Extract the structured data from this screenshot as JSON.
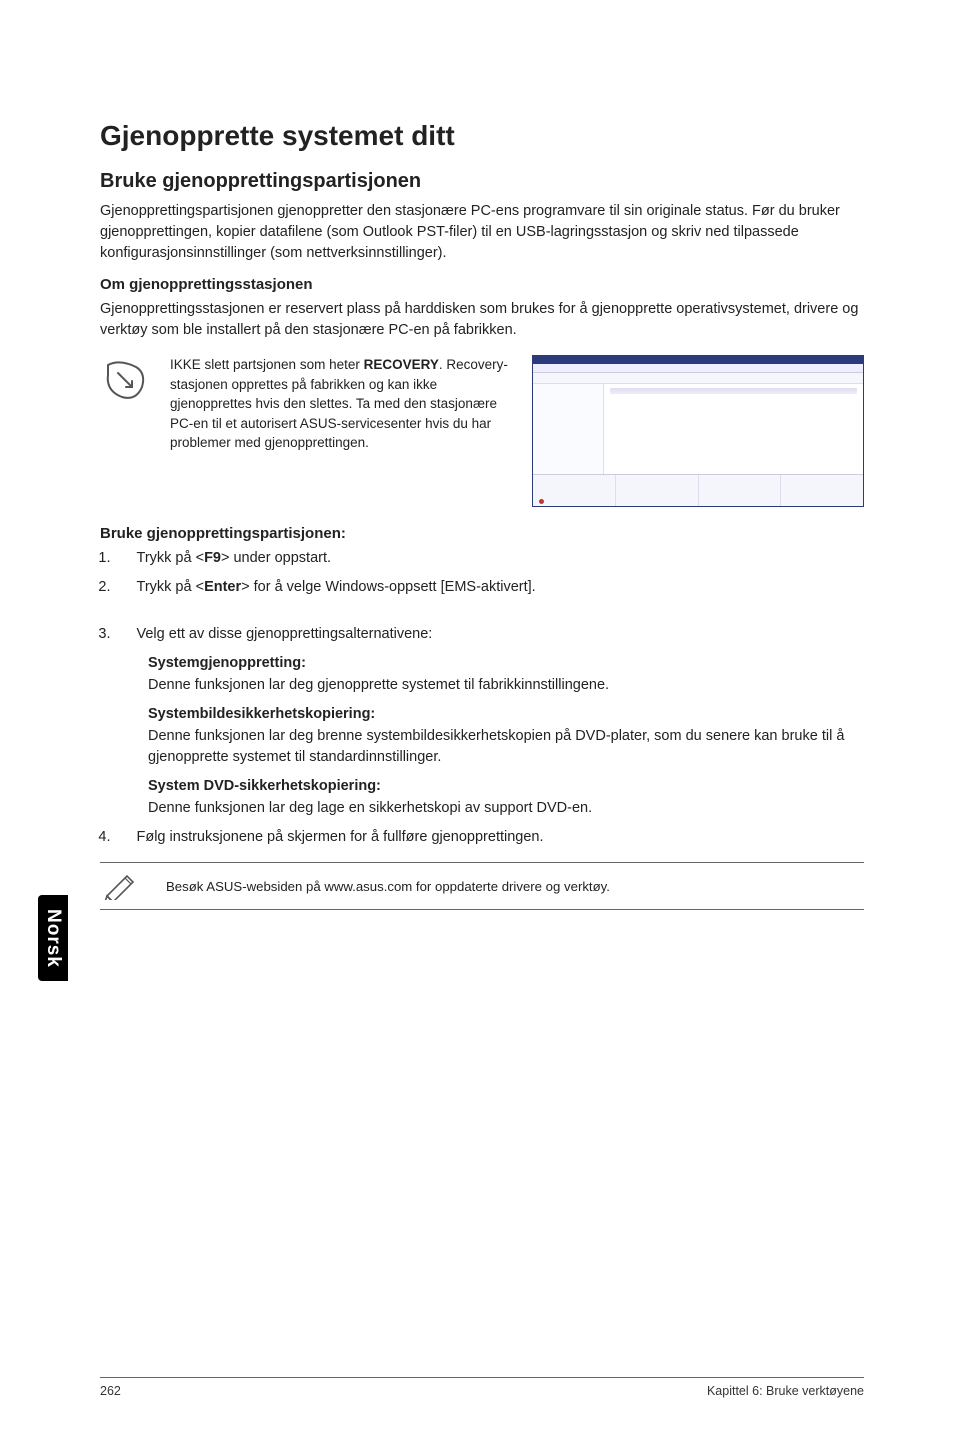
{
  "sideTab": "Norsk",
  "h1": "Gjenopprette systemet ditt",
  "h2": "Bruke gjenopprettingspartisjonen",
  "intro": "Gjenopprettingspartisjonen gjenoppretter den stasjonære PC-ens programvare til sin originale status. Før du bruker gjenopprettingen, kopier datafilene (som Outlook PST-filer) til en USB-lagringsstasjon og skriv ned tilpassede konfigurasjonsinnstillinger (som nettverksinnstillinger).",
  "h3a": "Om gjenopprettingsstasjonen",
  "about": "Gjenopprettingsstasjonen er reservert plass på harddisken som brukes for å gjenopprette operativsystemet, drivere og verktøy som ble installert på den stasjonære PC-en på fabrikken.",
  "warning_pre": "IKKE slett partsjonen som heter ",
  "warning_bold": "RECOVERY",
  "warning_post": ". Recovery-stasjonen opprettes på fabrikken og kan ikke gjenopprettes hvis den slettes. Ta med den stasjonære PC-en til et autorisert ASUS-servicesenter hvis du har problemer med gjenopprettingen.",
  "h3b": "Bruke gjenopprettingspartisjonen:",
  "steps": {
    "s1_pre": "Trykk på <",
    "s1_bold": "F9",
    "s1_post": "> under oppstart.",
    "s2_pre": "Trykk på <",
    "s2_bold": "Enter",
    "s2_post": "> for å velge Windows-oppsett [EMS-aktivert].",
    "s3": "Velg ett av disse gjenopprettingsalternativene:",
    "s4": "Følg instruksjonene på skjermen for å fullføre gjenopprettingen."
  },
  "subs": {
    "t1": "Systemgjenoppretting:",
    "b1": "Denne funksjonen lar deg gjenopprette systemet til fabrikkinnstillingene.",
    "t2": "Systembildesikkerhetskopiering:",
    "b2": "Denne funksjonen lar deg brenne systembildesikkerhetskopien på DVD-plater, som du senere kan bruke til å gjenopprette systemet til standardinnstillinger.",
    "t3": "System DVD-sikkerhetskopiering:",
    "b3": "Denne funksjonen lar deg lage en sikkerhetskopi av support DVD-en."
  },
  "infoNote": "Besøk ASUS-websiden på www.asus.com for oppdaterte drivere og verktøy.",
  "footer": {
    "page": "262",
    "chapter": "Kapittel 6: Bruke verktøyene"
  }
}
